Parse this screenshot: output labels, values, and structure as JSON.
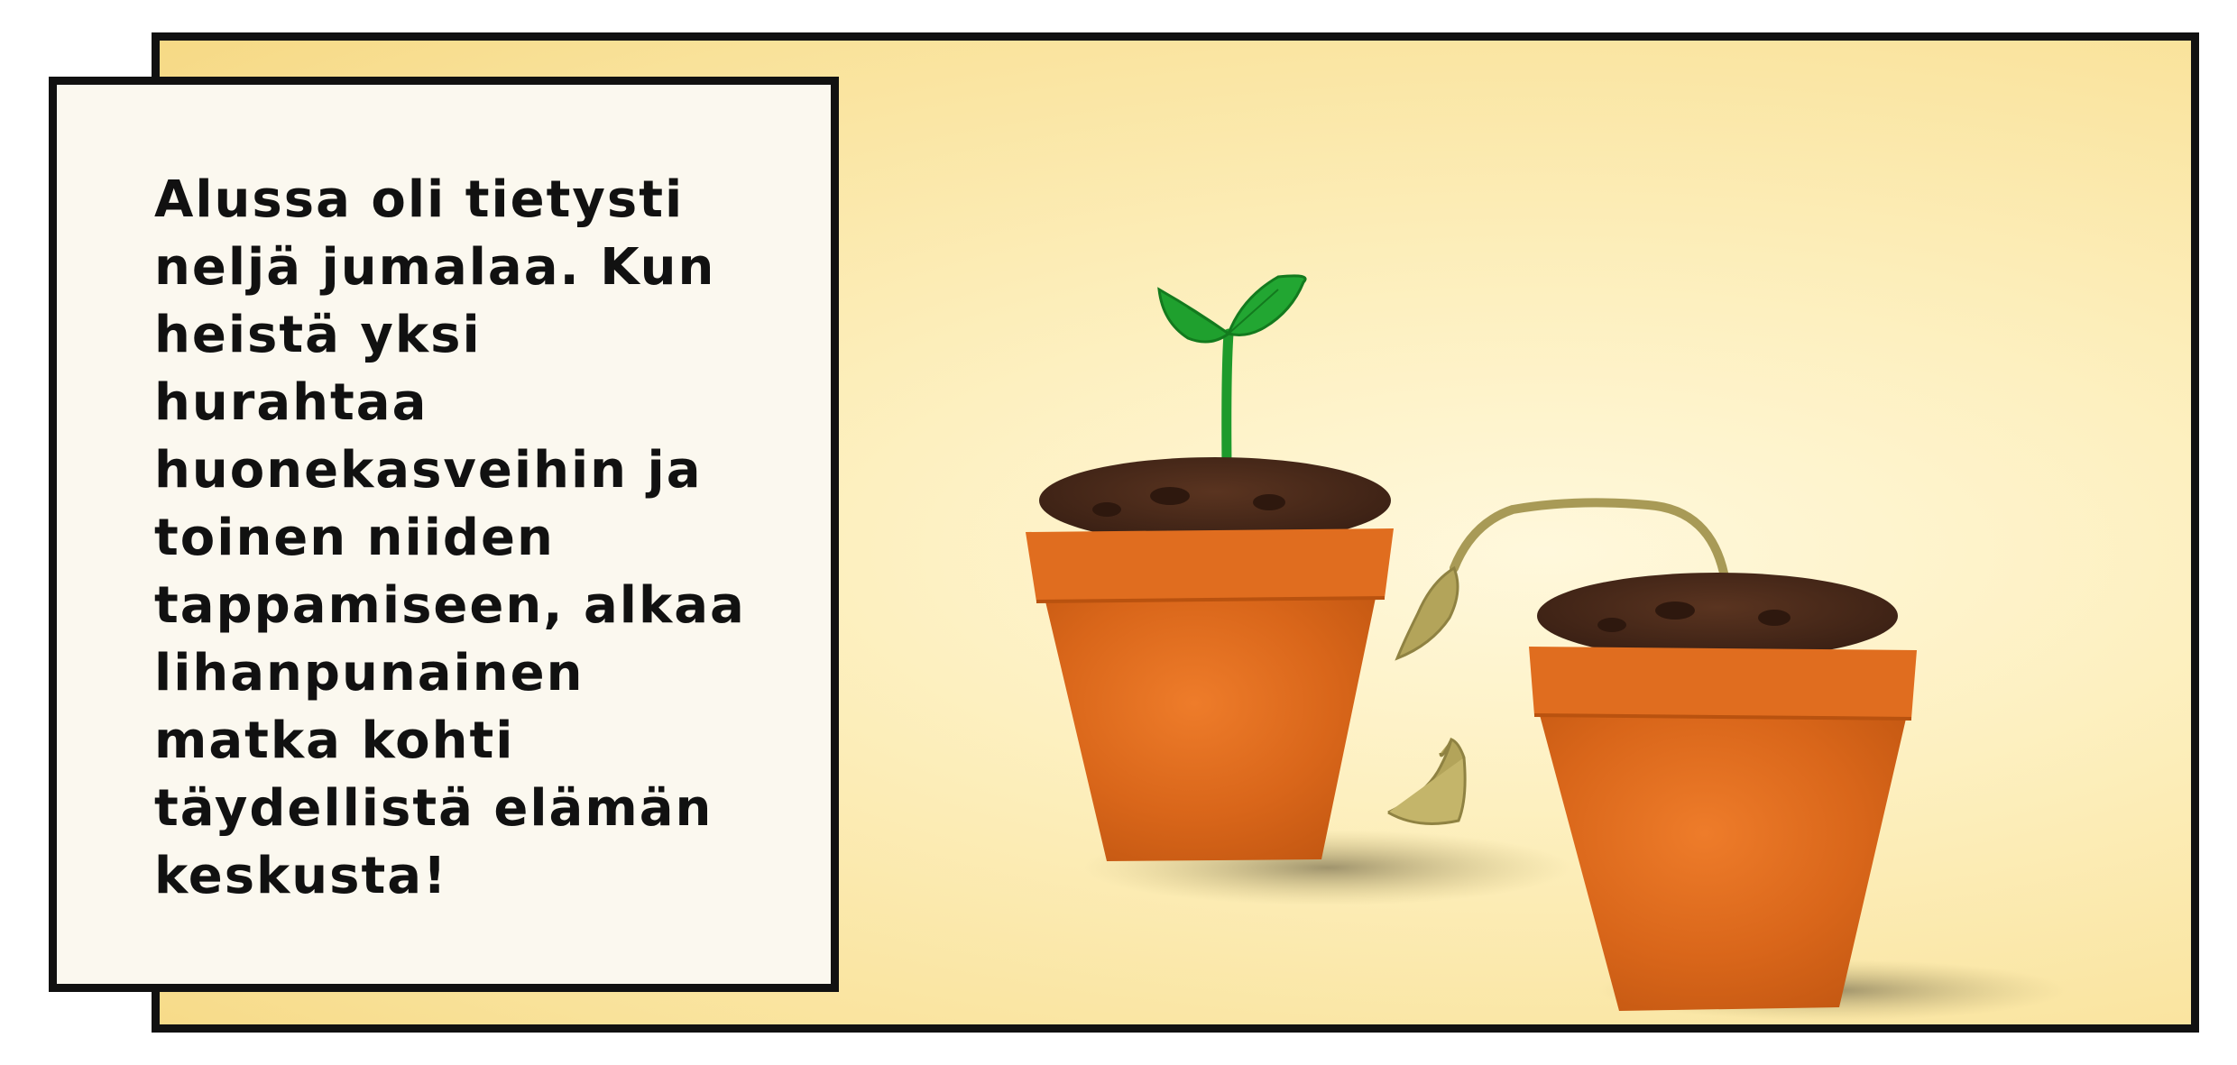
{
  "caption": {
    "text": "Alussa oli tietysti\nneljä jumalaa. Kun\nheistä yksi\nhurahtaa\nhuonekasveihin ja\ntoinen niiden\ntappamiseen, alkaa\nlihanpunainen\nmatka kohti\ntäydellistä elämän\nkeskusta!"
  },
  "scene": {
    "description_items": [
      "healthy-sprout-pot",
      "wilted-plant-pot",
      "fallen-leaf"
    ],
    "colors": {
      "background": "#f9e29a",
      "pot": "#d9661a",
      "pot_rim": "#e2701f",
      "soil": "#4a2a18",
      "sprout": "#1e9a2c",
      "wilted": "#a89a56",
      "border": "#111111"
    }
  }
}
